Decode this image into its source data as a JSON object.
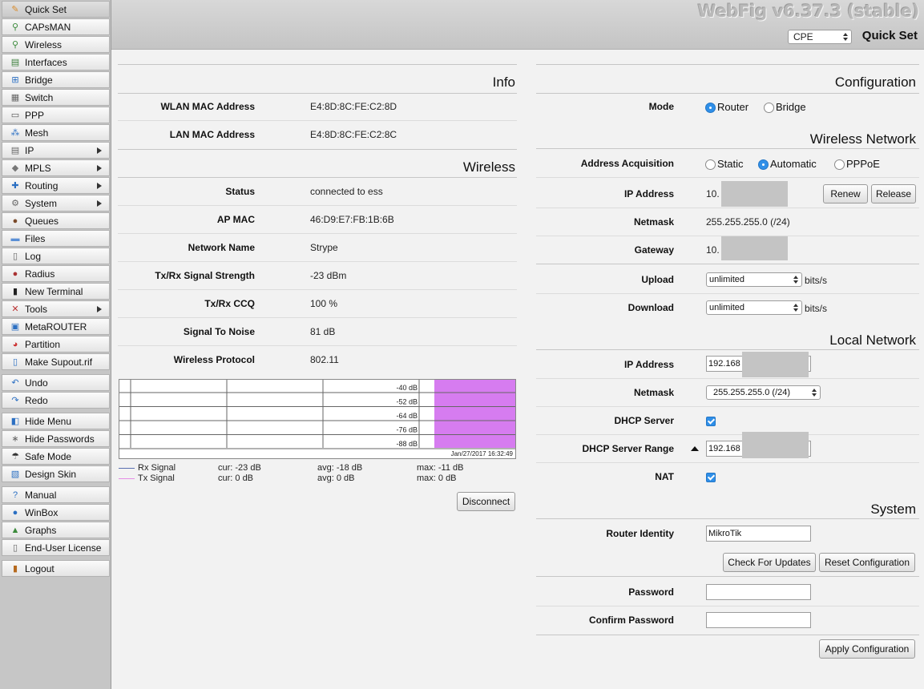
{
  "sidebar": {
    "items": [
      {
        "label": "Quick Set",
        "icon": "quick-set-icon",
        "submenu": false,
        "active": true
      },
      {
        "label": "CAPsMAN",
        "icon": "capsman-icon",
        "submenu": false
      },
      {
        "label": "Wireless",
        "icon": "wireless-icon",
        "submenu": false
      },
      {
        "label": "Interfaces",
        "icon": "interfaces-icon",
        "submenu": false
      },
      {
        "label": "Bridge",
        "icon": "bridge-icon",
        "submenu": false
      },
      {
        "label": "Switch",
        "icon": "switch-icon",
        "submenu": false
      },
      {
        "label": "PPP",
        "icon": "ppp-icon",
        "submenu": false
      },
      {
        "label": "Mesh",
        "icon": "mesh-icon",
        "submenu": false
      },
      {
        "label": "IP",
        "icon": "ip-icon",
        "submenu": true
      },
      {
        "label": "MPLS",
        "icon": "mpls-icon",
        "submenu": true
      },
      {
        "label": "Routing",
        "icon": "routing-icon",
        "submenu": true
      },
      {
        "label": "System",
        "icon": "system-icon",
        "submenu": true
      },
      {
        "label": "Queues",
        "icon": "queues-icon",
        "submenu": false
      },
      {
        "label": "Files",
        "icon": "files-icon",
        "submenu": false
      },
      {
        "label": "Log",
        "icon": "log-icon",
        "submenu": false
      },
      {
        "label": "Radius",
        "icon": "radius-icon",
        "submenu": false
      },
      {
        "label": "New Terminal",
        "icon": "terminal-icon",
        "submenu": false
      },
      {
        "label": "Tools",
        "icon": "tools-icon",
        "submenu": true
      },
      {
        "label": "MetaROUTER",
        "icon": "metarouter-icon",
        "submenu": false
      },
      {
        "label": "Partition",
        "icon": "partition-icon",
        "submenu": false
      },
      {
        "label": "Make Supout.rif",
        "icon": "supout-icon",
        "submenu": false
      },
      {
        "label": "Undo",
        "icon": "undo-icon",
        "submenu": false
      },
      {
        "label": "Redo",
        "icon": "redo-icon",
        "submenu": false
      },
      {
        "label": "Hide Menu",
        "icon": "hide-menu-icon",
        "submenu": false
      },
      {
        "label": "Hide Passwords",
        "icon": "hide-passwords-icon",
        "submenu": false
      },
      {
        "label": "Safe Mode",
        "icon": "safe-mode-icon",
        "submenu": false
      },
      {
        "label": "Design Skin",
        "icon": "design-skin-icon",
        "submenu": false
      },
      {
        "label": "Manual",
        "icon": "manual-icon",
        "submenu": false
      },
      {
        "label": "WinBox",
        "icon": "winbox-icon",
        "submenu": false
      },
      {
        "label": "Graphs",
        "icon": "graphs-icon",
        "submenu": false
      },
      {
        "label": "End-User License",
        "icon": "license-icon",
        "submenu": false
      },
      {
        "label": "Logout",
        "icon": "logout-icon",
        "submenu": false
      }
    ]
  },
  "header": {
    "app_title": "WebFig v6.37.3 (stable)",
    "mode_select": "CPE",
    "page_title": "Quick Set"
  },
  "info": {
    "title": "Info",
    "wlan_mac_label": "WLAN MAC Address",
    "wlan_mac_value": "E4:8D:8C:FE:C2:8D",
    "lan_mac_label": "LAN MAC Address",
    "lan_mac_value": "E4:8D:8C:FE:C2:8C"
  },
  "wireless": {
    "title": "Wireless",
    "status_label": "Status",
    "status_value": "connected to ess",
    "ap_mac_label": "AP MAC",
    "ap_mac_value": "46:D9:E7:FB:1B:6B",
    "network_name_label": "Network Name",
    "network_name_value": "Strype",
    "signal_strength_label": "Tx/Rx Signal Strength",
    "signal_strength_value": "-23 dBm",
    "ccq_label": "Tx/Rx CCQ",
    "ccq_value": "100 %",
    "snr_label": "Signal To Noise",
    "snr_value": "81 dB",
    "protocol_label": "Wireless Protocol",
    "protocol_value": "802.11",
    "disconnect_button": "Disconnect"
  },
  "chart_data": {
    "type": "line",
    "y_tick_labels": [
      "-40 dB",
      "-52 dB",
      "-64 dB",
      "-76 dB",
      "-88 dB"
    ],
    "timestamp": "Jan/27/2017 16:32:49",
    "series": [
      {
        "name": "Rx Signal",
        "color": "#5a6fb0",
        "cur": "cur: -23 dB",
        "avg": "avg: -18 dB",
        "max": "max: -11 dB"
      },
      {
        "name": "Tx Signal",
        "color": "#e58ee6",
        "cur": "cur: 0 dB",
        "avg": "avg: 0 dB",
        "max": "max: 0 dB"
      }
    ],
    "fill_color": "#d67cf0"
  },
  "configuration": {
    "title": "Configuration",
    "mode_label": "Mode",
    "mode_router": "Router",
    "mode_bridge": "Bridge",
    "mode_selected": "Router"
  },
  "wireless_network": {
    "title": "Wireless Network",
    "address_acquisition_label": "Address Acquisition",
    "acq_static": "Static",
    "acq_automatic": "Automatic",
    "acq_pppoe": "PPPoE",
    "acq_selected": "Automatic",
    "ip_address_label": "IP Address",
    "ip_address_value": "10.",
    "renew_button": "Renew",
    "release_button": "Release",
    "netmask_label": "Netmask",
    "netmask_value": "255.255.255.0 (/24)",
    "gateway_label": "Gateway",
    "gateway_value": "10.",
    "upload_label": "Upload",
    "upload_value": "unlimited",
    "download_label": "Download",
    "download_value": "unlimited",
    "unit": "bits/s"
  },
  "local_network": {
    "title": "Local Network",
    "ip_address_label": "IP Address",
    "ip_address_value": "192.168",
    "netmask_label": "Netmask",
    "netmask_value": "255.255.255.0 (/24)",
    "dhcp_server_label": "DHCP Server",
    "dhcp_server_checked": true,
    "dhcp_range_label": "DHCP Server Range",
    "dhcp_range_value": "192.168",
    "nat_label": "NAT",
    "nat_checked": true
  },
  "system": {
    "title": "System",
    "router_identity_label": "Router Identity",
    "router_identity_value": "MikroTik",
    "check_updates_button": "Check For Updates",
    "reset_config_button": "Reset Configuration",
    "password_label": "Password",
    "password_value": "",
    "confirm_password_label": "Confirm Password",
    "confirm_password_value": "",
    "apply_button": "Apply Configuration"
  },
  "colors": {
    "accent": "#2f8fe8",
    "sidebar_bg": "#c6c6c6",
    "chart_fill": "#d67cf0"
  }
}
